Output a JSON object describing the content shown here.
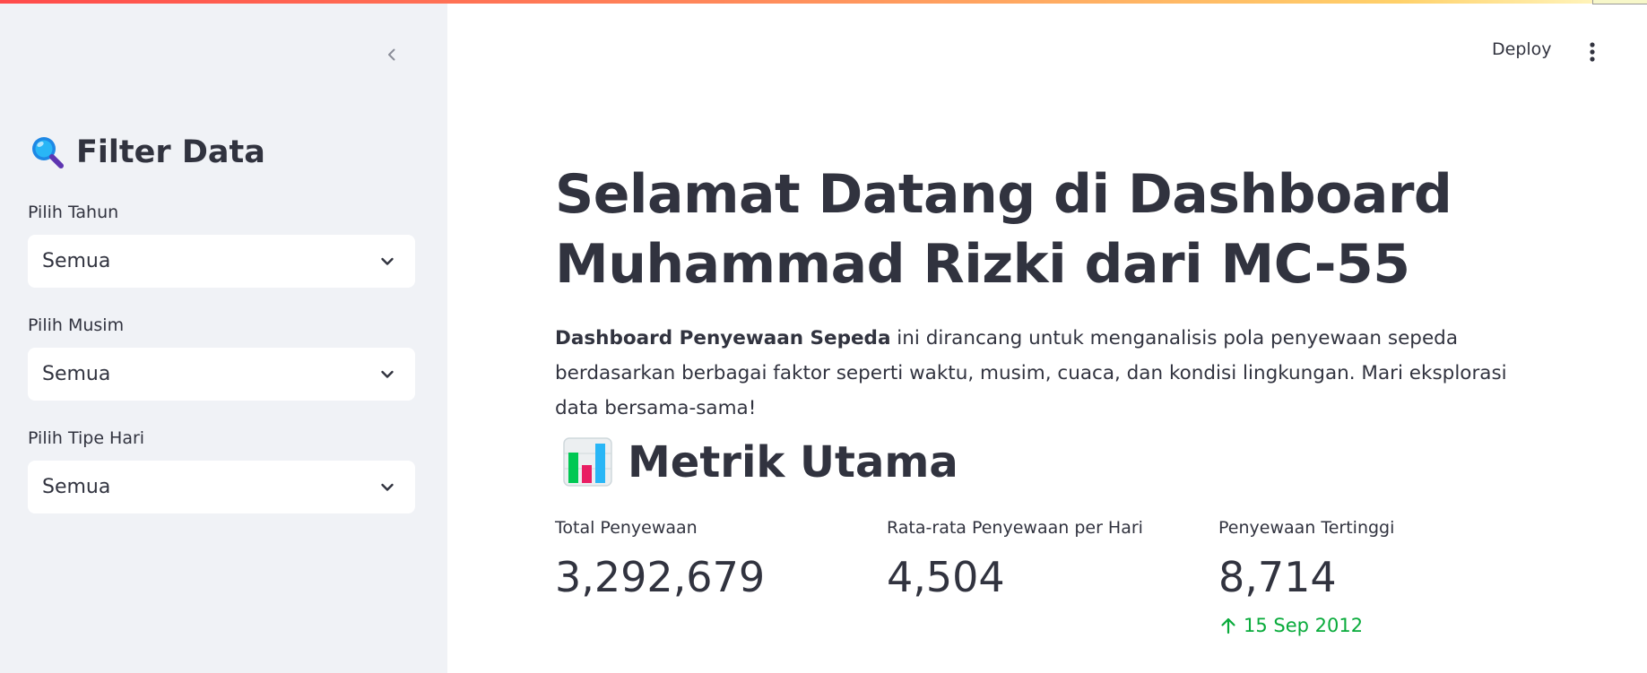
{
  "sidebar": {
    "title": "Filter Data",
    "filters": [
      {
        "label": "Pilih Tahun",
        "value": "Semua"
      },
      {
        "label": "Pilih Musim",
        "value": "Semua"
      },
      {
        "label": "Pilih Tipe Hari",
        "value": "Semua"
      }
    ]
  },
  "header": {
    "deploy_label": "Deploy"
  },
  "main": {
    "title": "Selamat Datang di Dashboard Muhammad Rizki dari MC-55",
    "intro_bold": "Dashboard Penyewaan Sepeda",
    "intro_rest": " ini dirancang untuk menganalisis pola penyewaan sepeda berdasarkan berbagai faktor seperti waktu, musim, cuaca, dan kondisi lingkungan. Mari eksplorasi data bersama-sama!",
    "section_title": "Metrik Utama",
    "metrics": [
      {
        "label": "Total Penyewaan",
        "value": "3,292,679"
      },
      {
        "label": "Rata-rata Penyewaan per Hari",
        "value": "4,504"
      },
      {
        "label": "Penyewaan Tertinggi",
        "value": "8,714",
        "delta": "15 Sep 2012"
      }
    ]
  },
  "colors": {
    "sidebar_bg": "#f0f2f6",
    "text": "#31333f",
    "delta_positive": "#09ab3b"
  }
}
